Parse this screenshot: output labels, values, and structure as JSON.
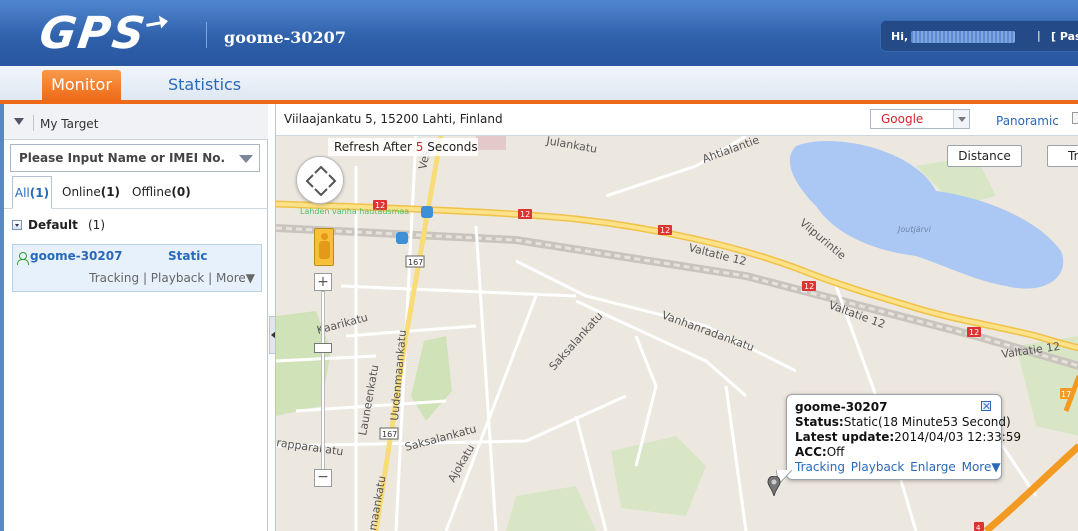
{
  "header": {
    "logo": "GPS",
    "device_title": "goome-30207",
    "user_greeting": "Hi,",
    "user_pipe": "|",
    "password_link": "[ Pas"
  },
  "nav": {
    "tabs": [
      {
        "label": "Monitor",
        "active": true
      },
      {
        "label": "Statistics",
        "active": false
      }
    ]
  },
  "sidebar": {
    "title": "My Target",
    "search_placeholder": "Please Input Name or IMEI No.",
    "filters": {
      "all_label": "All",
      "all_count": "(1)",
      "online_label": "Online",
      "online_count": "(1)",
      "offline_label": "Offline",
      "offline_count": "(0)"
    },
    "group": {
      "name": "Default",
      "count": "(1)"
    },
    "device": {
      "name": "goome-30207",
      "status": "Static",
      "actions": [
        "Tracking",
        "Playback",
        "More▼"
      ],
      "separator": " | "
    }
  },
  "map": {
    "address": "Viilaajankatu 5, 15200 Lahti, Finland",
    "provider": "Google",
    "panoramic": "Panoramic",
    "refresh": {
      "prefix": "Refresh After ",
      "seconds": "5",
      "suffix": " Seconds"
    },
    "buttons": {
      "distance": "Distance",
      "tr": "Tr"
    },
    "zoom_in": "+",
    "zoom_out": "−",
    "labels": {
      "valtatie": "Valtatie 12",
      "viipurintie": "Viipurintie",
      "saksalankatu": "Saksalankatu",
      "vanhanradankatu": "Vanhanradankatu",
      "uudenmaankatu": "Uudenmaankatu",
      "kaarikatu": "Kaarikatu",
      "launeenkatu": "Launeenkatu",
      "ajokatu": "Ajokatu",
      "joutjarvi": "Joutjärvi",
      "ahtialantie": "Ahtialantie",
      "cemetery": "Lahden vanha hautausmaa",
      "route12": "12",
      "route167": "167",
      "route17": "17",
      "route4": "4",
      "julankatu": "Julankatu",
      "rapparakatu": "rapparakatu",
      "ves": "Ves",
      "mannaankatu": "maankatu"
    },
    "popup": {
      "title": "goome-30207",
      "status_label": "Status:",
      "status_value": "Static(18 Minute53 Second)",
      "update_label": "Latest update:",
      "update_value": "2014/04/03 12:33:59",
      "acc_label": "ACC:",
      "acc_value": "Off",
      "links": [
        "Tracking",
        "Playback",
        "Enlarge",
        "More▼"
      ]
    }
  },
  "colors": {
    "header_blue": "#2e5fa9",
    "accent_orange": "#ef6a18",
    "link_blue": "#2a69b8",
    "status_red": "#d0262b"
  }
}
